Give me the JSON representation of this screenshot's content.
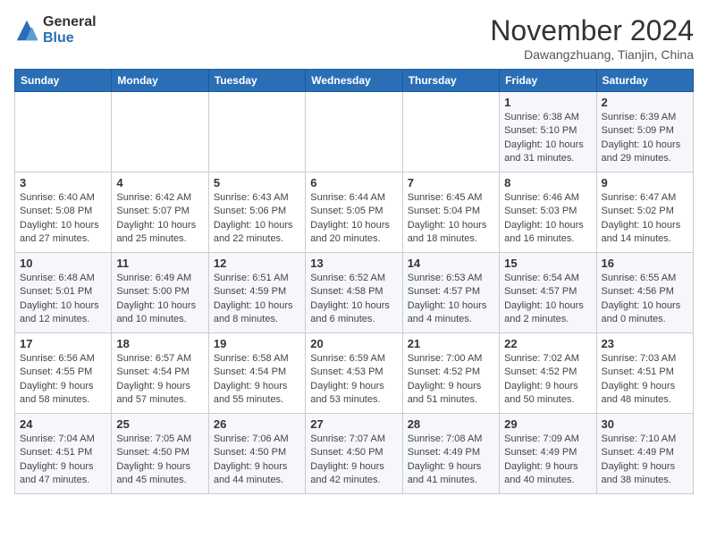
{
  "header": {
    "logo_general": "General",
    "logo_blue": "Blue",
    "month_title": "November 2024",
    "location": "Dawangzhuang, Tianjin, China"
  },
  "weekdays": [
    "Sunday",
    "Monday",
    "Tuesday",
    "Wednesday",
    "Thursday",
    "Friday",
    "Saturday"
  ],
  "weeks": [
    [
      {
        "day": "",
        "info": ""
      },
      {
        "day": "",
        "info": ""
      },
      {
        "day": "",
        "info": ""
      },
      {
        "day": "",
        "info": ""
      },
      {
        "day": "",
        "info": ""
      },
      {
        "day": "1",
        "info": "Sunrise: 6:38 AM\nSunset: 5:10 PM\nDaylight: 10 hours and 31 minutes."
      },
      {
        "day": "2",
        "info": "Sunrise: 6:39 AM\nSunset: 5:09 PM\nDaylight: 10 hours and 29 minutes."
      }
    ],
    [
      {
        "day": "3",
        "info": "Sunrise: 6:40 AM\nSunset: 5:08 PM\nDaylight: 10 hours and 27 minutes."
      },
      {
        "day": "4",
        "info": "Sunrise: 6:42 AM\nSunset: 5:07 PM\nDaylight: 10 hours and 25 minutes."
      },
      {
        "day": "5",
        "info": "Sunrise: 6:43 AM\nSunset: 5:06 PM\nDaylight: 10 hours and 22 minutes."
      },
      {
        "day": "6",
        "info": "Sunrise: 6:44 AM\nSunset: 5:05 PM\nDaylight: 10 hours and 20 minutes."
      },
      {
        "day": "7",
        "info": "Sunrise: 6:45 AM\nSunset: 5:04 PM\nDaylight: 10 hours and 18 minutes."
      },
      {
        "day": "8",
        "info": "Sunrise: 6:46 AM\nSunset: 5:03 PM\nDaylight: 10 hours and 16 minutes."
      },
      {
        "day": "9",
        "info": "Sunrise: 6:47 AM\nSunset: 5:02 PM\nDaylight: 10 hours and 14 minutes."
      }
    ],
    [
      {
        "day": "10",
        "info": "Sunrise: 6:48 AM\nSunset: 5:01 PM\nDaylight: 10 hours and 12 minutes."
      },
      {
        "day": "11",
        "info": "Sunrise: 6:49 AM\nSunset: 5:00 PM\nDaylight: 10 hours and 10 minutes."
      },
      {
        "day": "12",
        "info": "Sunrise: 6:51 AM\nSunset: 4:59 PM\nDaylight: 10 hours and 8 minutes."
      },
      {
        "day": "13",
        "info": "Sunrise: 6:52 AM\nSunset: 4:58 PM\nDaylight: 10 hours and 6 minutes."
      },
      {
        "day": "14",
        "info": "Sunrise: 6:53 AM\nSunset: 4:57 PM\nDaylight: 10 hours and 4 minutes."
      },
      {
        "day": "15",
        "info": "Sunrise: 6:54 AM\nSunset: 4:57 PM\nDaylight: 10 hours and 2 minutes."
      },
      {
        "day": "16",
        "info": "Sunrise: 6:55 AM\nSunset: 4:56 PM\nDaylight: 10 hours and 0 minutes."
      }
    ],
    [
      {
        "day": "17",
        "info": "Sunrise: 6:56 AM\nSunset: 4:55 PM\nDaylight: 9 hours and 58 minutes."
      },
      {
        "day": "18",
        "info": "Sunrise: 6:57 AM\nSunset: 4:54 PM\nDaylight: 9 hours and 57 minutes."
      },
      {
        "day": "19",
        "info": "Sunrise: 6:58 AM\nSunset: 4:54 PM\nDaylight: 9 hours and 55 minutes."
      },
      {
        "day": "20",
        "info": "Sunrise: 6:59 AM\nSunset: 4:53 PM\nDaylight: 9 hours and 53 minutes."
      },
      {
        "day": "21",
        "info": "Sunrise: 7:00 AM\nSunset: 4:52 PM\nDaylight: 9 hours and 51 minutes."
      },
      {
        "day": "22",
        "info": "Sunrise: 7:02 AM\nSunset: 4:52 PM\nDaylight: 9 hours and 50 minutes."
      },
      {
        "day": "23",
        "info": "Sunrise: 7:03 AM\nSunset: 4:51 PM\nDaylight: 9 hours and 48 minutes."
      }
    ],
    [
      {
        "day": "24",
        "info": "Sunrise: 7:04 AM\nSunset: 4:51 PM\nDaylight: 9 hours and 47 minutes."
      },
      {
        "day": "25",
        "info": "Sunrise: 7:05 AM\nSunset: 4:50 PM\nDaylight: 9 hours and 45 minutes."
      },
      {
        "day": "26",
        "info": "Sunrise: 7:06 AM\nSunset: 4:50 PM\nDaylight: 9 hours and 44 minutes."
      },
      {
        "day": "27",
        "info": "Sunrise: 7:07 AM\nSunset: 4:50 PM\nDaylight: 9 hours and 42 minutes."
      },
      {
        "day": "28",
        "info": "Sunrise: 7:08 AM\nSunset: 4:49 PM\nDaylight: 9 hours and 41 minutes."
      },
      {
        "day": "29",
        "info": "Sunrise: 7:09 AM\nSunset: 4:49 PM\nDaylight: 9 hours and 40 minutes."
      },
      {
        "day": "30",
        "info": "Sunrise: 7:10 AM\nSunset: 4:49 PM\nDaylight: 9 hours and 38 minutes."
      }
    ]
  ]
}
